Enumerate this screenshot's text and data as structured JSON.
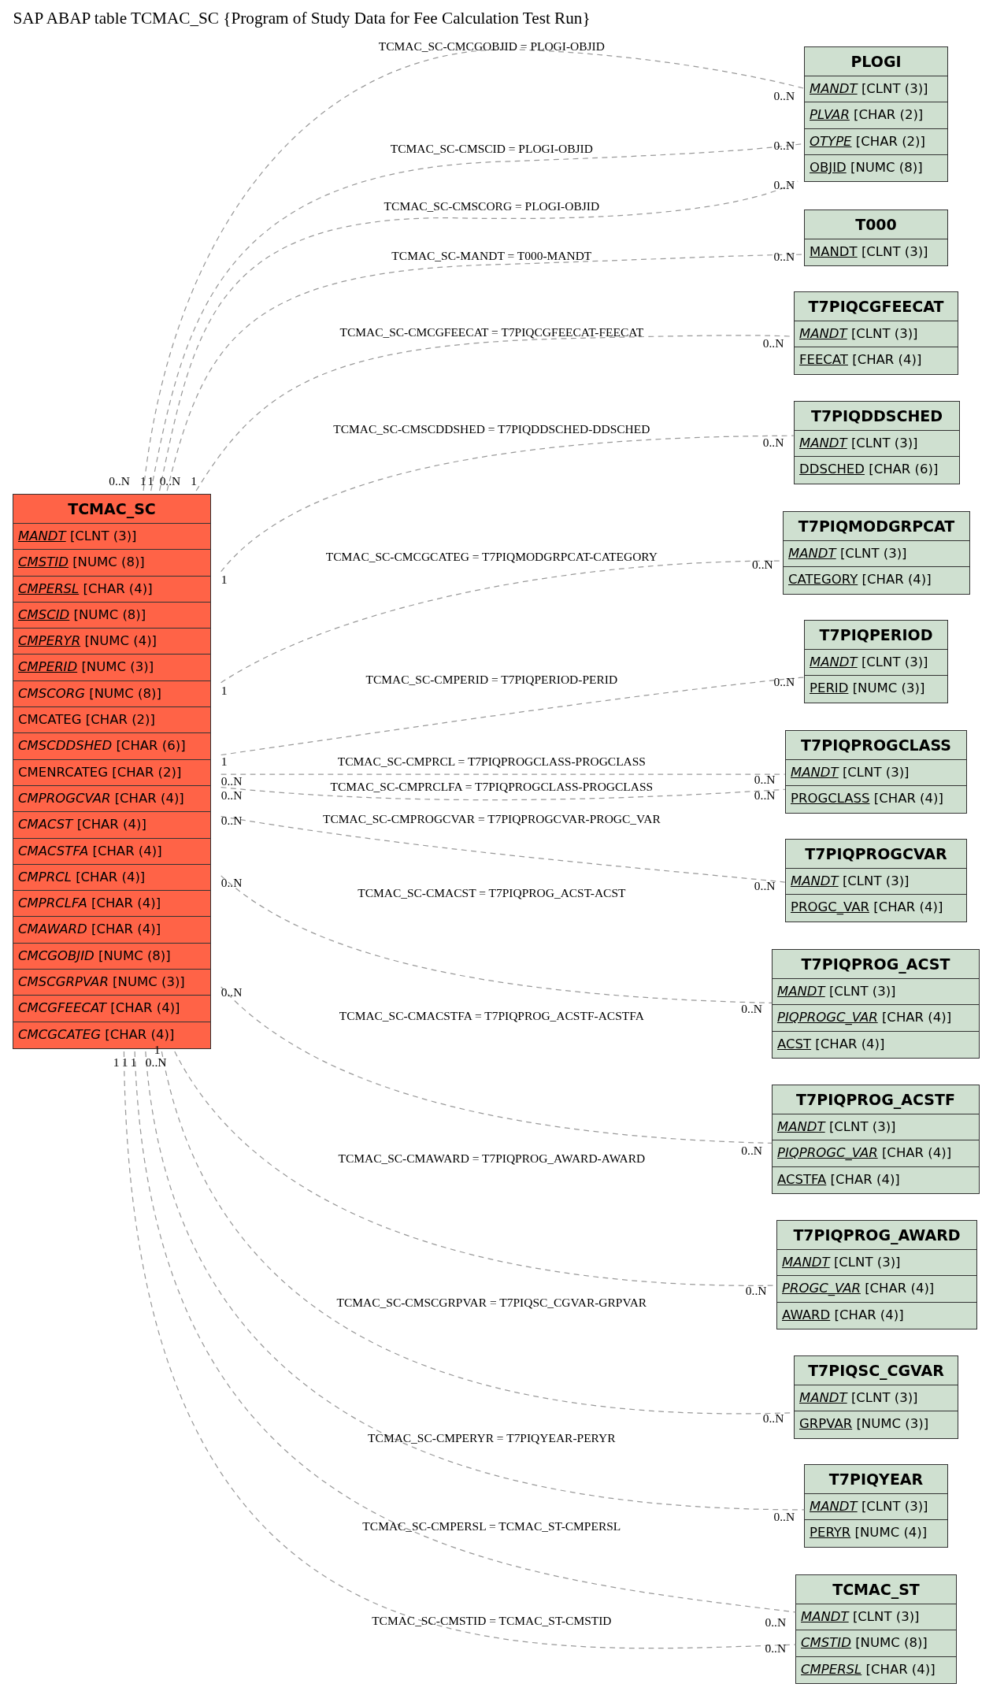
{
  "title": "SAP ABAP table TCMAC_SC {Program of Study Data for Fee Calculation Test Run}",
  "tables": [
    {
      "name": "TCMAC_SC",
      "kind": "main",
      "fields": [
        {
          "name": "MANDT",
          "type": "[CLNT (3)]",
          "key": true,
          "foreign": true
        },
        {
          "name": "CMSTID",
          "type": "[NUMC (8)]",
          "key": true,
          "foreign": true
        },
        {
          "name": "CMPERSL",
          "type": "[CHAR (4)]",
          "key": true,
          "foreign": true
        },
        {
          "name": "CMSCID",
          "type": "[NUMC (8)]",
          "key": true,
          "foreign": true
        },
        {
          "name": "CMPERYR",
          "type": "[NUMC (4)]",
          "key": true,
          "foreign": true
        },
        {
          "name": "CMPERID",
          "type": "[NUMC (3)]",
          "key": true,
          "foreign": true
        },
        {
          "name": "CMSCORG",
          "type": "[NUMC (8)]",
          "key": false,
          "foreign": true
        },
        {
          "name": "CMCATEG",
          "type": "[CHAR (2)]",
          "key": false,
          "foreign": false
        },
        {
          "name": "CMSCDDSHED",
          "type": "[CHAR (6)]",
          "key": false,
          "foreign": true
        },
        {
          "name": "CMENRCATEG",
          "type": "[CHAR (2)]",
          "key": false,
          "foreign": false
        },
        {
          "name": "CMPROGCVAR",
          "type": "[CHAR (4)]",
          "key": false,
          "foreign": true
        },
        {
          "name": "CMACST",
          "type": "[CHAR (4)]",
          "key": false,
          "foreign": true
        },
        {
          "name": "CMACSTFA",
          "type": "[CHAR (4)]",
          "key": false,
          "foreign": true
        },
        {
          "name": "CMPRCL",
          "type": "[CHAR (4)]",
          "key": false,
          "foreign": true
        },
        {
          "name": "CMPRCLFA",
          "type": "[CHAR (4)]",
          "key": false,
          "foreign": true
        },
        {
          "name": "CMAWARD",
          "type": "[CHAR (4)]",
          "key": false,
          "foreign": true
        },
        {
          "name": "CMCGOBJID",
          "type": "[NUMC (8)]",
          "key": false,
          "foreign": true
        },
        {
          "name": "CMSCGRPVAR",
          "type": "[NUMC (3)]",
          "key": false,
          "foreign": true
        },
        {
          "name": "CMCGFEECAT",
          "type": "[CHAR (4)]",
          "key": false,
          "foreign": true
        },
        {
          "name": "CMCGCATEG",
          "type": "[CHAR (4)]",
          "key": false,
          "foreign": true
        }
      ]
    },
    {
      "name": "PLOGI",
      "kind": "related",
      "fields": [
        {
          "name": "MANDT",
          "type": "[CLNT (3)]",
          "key": true,
          "foreign": true
        },
        {
          "name": "PLVAR",
          "type": "[CHAR (2)]",
          "key": true,
          "foreign": true
        },
        {
          "name": "OTYPE",
          "type": "[CHAR (2)]",
          "key": true,
          "foreign": true
        },
        {
          "name": "OBJID",
          "type": "[NUMC (8)]",
          "key": true,
          "foreign": false
        }
      ]
    },
    {
      "name": "T000",
      "kind": "related",
      "fields": [
        {
          "name": "MANDT",
          "type": "[CLNT (3)]",
          "key": true,
          "foreign": false
        }
      ]
    },
    {
      "name": "T7PIQCGFEECAT",
      "kind": "related",
      "fields": [
        {
          "name": "MANDT",
          "type": "[CLNT (3)]",
          "key": true,
          "foreign": true
        },
        {
          "name": "FEECAT",
          "type": "[CHAR (4)]",
          "key": true,
          "foreign": false
        }
      ]
    },
    {
      "name": "T7PIQDDSCHED",
      "kind": "related",
      "fields": [
        {
          "name": "MANDT",
          "type": "[CLNT (3)]",
          "key": true,
          "foreign": true
        },
        {
          "name": "DDSCHED",
          "type": "[CHAR (6)]",
          "key": true,
          "foreign": false
        }
      ]
    },
    {
      "name": "T7PIQMODGRPCAT",
      "kind": "related",
      "fields": [
        {
          "name": "MANDT",
          "type": "[CLNT (3)]",
          "key": true,
          "foreign": true
        },
        {
          "name": "CATEGORY",
          "type": "[CHAR (4)]",
          "key": true,
          "foreign": false
        }
      ]
    },
    {
      "name": "T7PIQPERIOD",
      "kind": "related",
      "fields": [
        {
          "name": "MANDT",
          "type": "[CLNT (3)]",
          "key": true,
          "foreign": true
        },
        {
          "name": "PERID",
          "type": "[NUMC (3)]",
          "key": true,
          "foreign": false
        }
      ]
    },
    {
      "name": "T7PIQPROGCLASS",
      "kind": "related",
      "fields": [
        {
          "name": "MANDT",
          "type": "[CLNT (3)]",
          "key": true,
          "foreign": true
        },
        {
          "name": "PROGCLASS",
          "type": "[CHAR (4)]",
          "key": true,
          "foreign": false
        }
      ]
    },
    {
      "name": "T7PIQPROGCVAR",
      "kind": "related",
      "fields": [
        {
          "name": "MANDT",
          "type": "[CLNT (3)]",
          "key": true,
          "foreign": true
        },
        {
          "name": "PROGC_VAR",
          "type": "[CHAR (4)]",
          "key": true,
          "foreign": false
        }
      ]
    },
    {
      "name": "T7PIQPROG_ACST",
      "kind": "related",
      "fields": [
        {
          "name": "MANDT",
          "type": "[CLNT (3)]",
          "key": true,
          "foreign": true
        },
        {
          "name": "PIQPROGC_VAR",
          "type": "[CHAR (4)]",
          "key": true,
          "foreign": true
        },
        {
          "name": "ACST",
          "type": "[CHAR (4)]",
          "key": true,
          "foreign": false
        }
      ]
    },
    {
      "name": "T7PIQPROG_ACSTF",
      "kind": "related",
      "fields": [
        {
          "name": "MANDT",
          "type": "[CLNT (3)]",
          "key": true,
          "foreign": true
        },
        {
          "name": "PIQPROGC_VAR",
          "type": "[CHAR (4)]",
          "key": true,
          "foreign": true
        },
        {
          "name": "ACSTFA",
          "type": "[CHAR (4)]",
          "key": true,
          "foreign": false
        }
      ]
    },
    {
      "name": "T7PIQPROG_AWARD",
      "kind": "related",
      "fields": [
        {
          "name": "MANDT",
          "type": "[CLNT (3)]",
          "key": true,
          "foreign": true
        },
        {
          "name": "PROGC_VAR",
          "type": "[CHAR (4)]",
          "key": true,
          "foreign": true
        },
        {
          "name": "AWARD",
          "type": "[CHAR (4)]",
          "key": true,
          "foreign": false
        }
      ]
    },
    {
      "name": "T7PIQSC_CGVAR",
      "kind": "related",
      "fields": [
        {
          "name": "MANDT",
          "type": "[CLNT (3)]",
          "key": true,
          "foreign": true
        },
        {
          "name": "GRPVAR",
          "type": "[NUMC (3)]",
          "key": true,
          "foreign": false
        }
      ]
    },
    {
      "name": "T7PIQYEAR",
      "kind": "related",
      "fields": [
        {
          "name": "MANDT",
          "type": "[CLNT (3)]",
          "key": true,
          "foreign": true
        },
        {
          "name": "PERYR",
          "type": "[NUMC (4)]",
          "key": true,
          "foreign": false
        }
      ]
    },
    {
      "name": "TCMAC_ST",
      "kind": "related",
      "fields": [
        {
          "name": "MANDT",
          "type": "[CLNT (3)]",
          "key": true,
          "foreign": true
        },
        {
          "name": "CMSTID",
          "type": "[NUMC (8)]",
          "key": true,
          "foreign": true
        },
        {
          "name": "CMPERSL",
          "type": "[CHAR (4)]",
          "key": true,
          "foreign": true
        }
      ]
    }
  ],
  "relations": [
    {
      "label": "TCMAC_SC-CMCGOBJID = PLOGI-OBJID",
      "source_card": "0..N",
      "target_card": "0..N"
    },
    {
      "label": "TCMAC_SC-CMSCID = PLOGI-OBJID",
      "source_card": "1",
      "target_card": "0..N"
    },
    {
      "label": "TCMAC_SC-CMSCORG = PLOGI-OBJID",
      "source_card": "1",
      "target_card": "0..N"
    },
    {
      "label": "TCMAC_SC-MANDT = T000-MANDT",
      "source_card": "0..N",
      "target_card": "0..N"
    },
    {
      "label": "TCMAC_SC-CMCGFEECAT = T7PIQCGFEECAT-FEECAT",
      "source_card": "1",
      "target_card": "0..N"
    },
    {
      "label": "TCMAC_SC-CMSCDDSHED = T7PIQDDSCHED-DDSCHED",
      "source_card": "1",
      "target_card": "0..N"
    },
    {
      "label": "TCMAC_SC-CMCGCATEG = T7PIQMODGRPCAT-CATEGORY",
      "source_card": "1",
      "target_card": "0..N"
    },
    {
      "label": "TCMAC_SC-CMPERID = T7PIQPERIOD-PERID",
      "source_card": "1",
      "target_card": "0..N"
    },
    {
      "label": "TCMAC_SC-CMPRCL = T7PIQPROGCLASS-PROGCLASS",
      "source_card": "0..N",
      "target_card": "0..N"
    },
    {
      "label": "TCMAC_SC-CMPRCLFA = T7PIQPROGCLASS-PROGCLASS",
      "source_card": "0..N",
      "target_card": "0..N"
    },
    {
      "label": "TCMAC_SC-CMPROGCVAR = T7PIQPROGCVAR-PROGC_VAR",
      "source_card": "0..N",
      "target_card": "0..N"
    },
    {
      "label": "TCMAC_SC-CMACST = T7PIQPROG_ACST-ACST",
      "source_card": "0..N",
      "target_card": "0..N"
    },
    {
      "label": "TCMAC_SC-CMACSTFA = T7PIQPROG_ACSTF-ACSTFA",
      "source_card": "0..N",
      "target_card": "0..N"
    },
    {
      "label": "TCMAC_SC-CMAWARD = T7PIQPROG_AWARD-AWARD",
      "source_card": "1",
      "target_card": "0..N"
    },
    {
      "label": "TCMAC_SC-CMSCGRPVAR = T7PIQSC_CGVAR-GRPVAR",
      "source_card": "1",
      "target_card": "0..N"
    },
    {
      "label": "TCMAC_SC-CMPERYR = T7PIQYEAR-PERYR",
      "source_card": "1",
      "target_card": "0..N"
    },
    {
      "label": "TCMAC_SC-CMPERSL = TCMAC_ST-CMPERSL",
      "source_card": "1",
      "target_card": "0..N"
    },
    {
      "label": "TCMAC_SC-CMSTID = TCMAC_ST-CMSTID",
      "source_card": "0..N",
      "target_card": "0..N"
    }
  ]
}
